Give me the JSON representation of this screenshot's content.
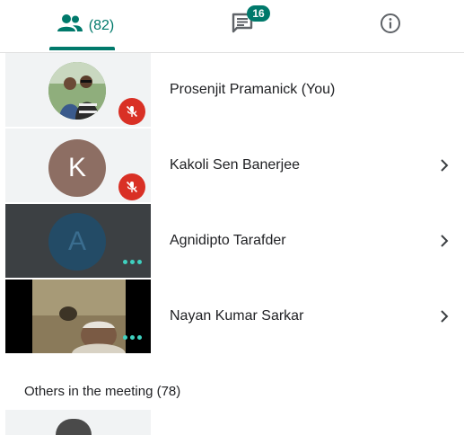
{
  "tabs": {
    "people_count": "(82)",
    "chat_badge": "16"
  },
  "participants": [
    {
      "name": "Prosenjit Pramanick (You)",
      "muted": true,
      "initial": ""
    },
    {
      "name": "Kakoli Sen Banerjee",
      "muted": true,
      "initial": "K"
    },
    {
      "name": "Agnidipto Tarafder",
      "muted": false,
      "initial": "A"
    },
    {
      "name": "Nayan Kumar Sarkar",
      "muted": false,
      "initial": ""
    }
  ],
  "others": {
    "header": "Others in the meeting (78)"
  },
  "colors": {
    "accent": "#00796b",
    "mute_red": "#d93025",
    "avatar_k": "#8d6e63",
    "avatar_a": "#234b66",
    "dots": "#3fd1c0"
  }
}
